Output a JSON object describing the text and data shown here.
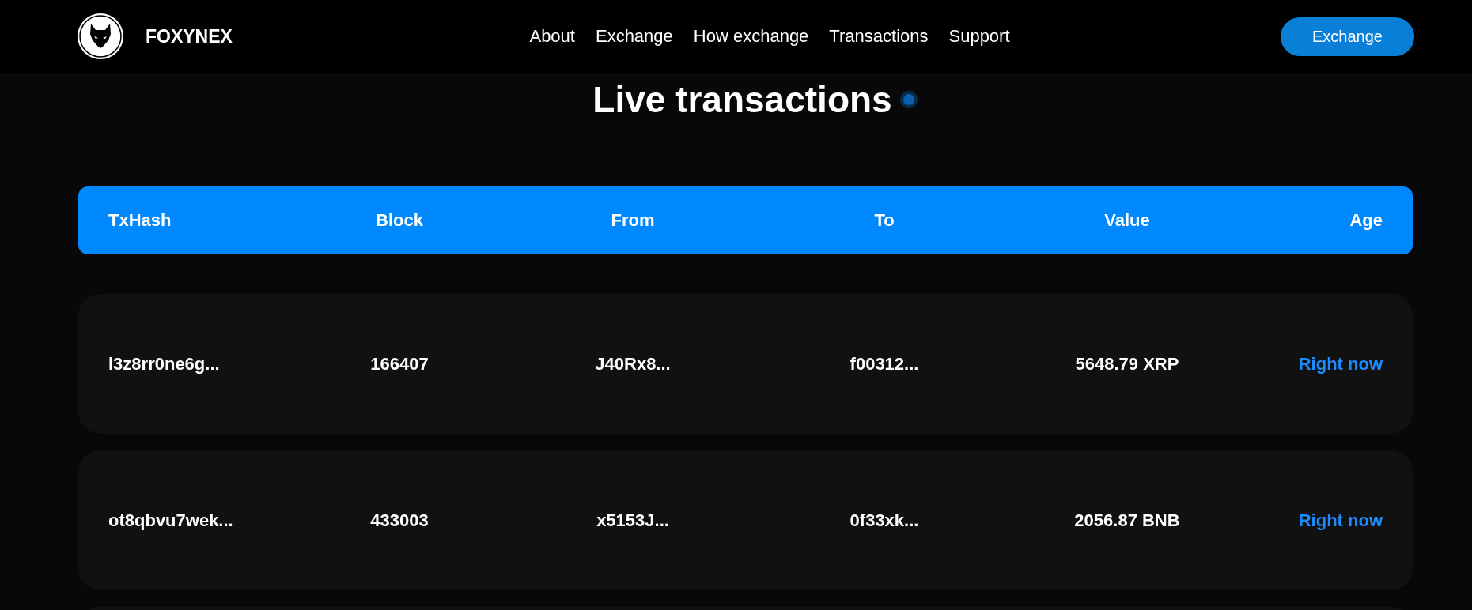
{
  "header": {
    "brand": "FOXYNEX",
    "nav": [
      "About",
      "Exchange",
      "How exchange",
      "Transactions",
      "Support"
    ],
    "button": "Exchange"
  },
  "title": "Live transactions",
  "table": {
    "columns": [
      "TxHash",
      "Block",
      "From",
      "To",
      "Value",
      "Age"
    ],
    "rows": [
      {
        "cells": [
          "l3z8rr0ne6g...",
          "166407",
          "J40Rx8...",
          "f00312...",
          "5648.79 XRP",
          "Right now"
        ]
      },
      {
        "cells": [
          "ot8qbvu7wek...",
          "433003",
          "x5153J...",
          "0f33xk...",
          "2056.87 BNB",
          "Right now"
        ]
      }
    ]
  }
}
